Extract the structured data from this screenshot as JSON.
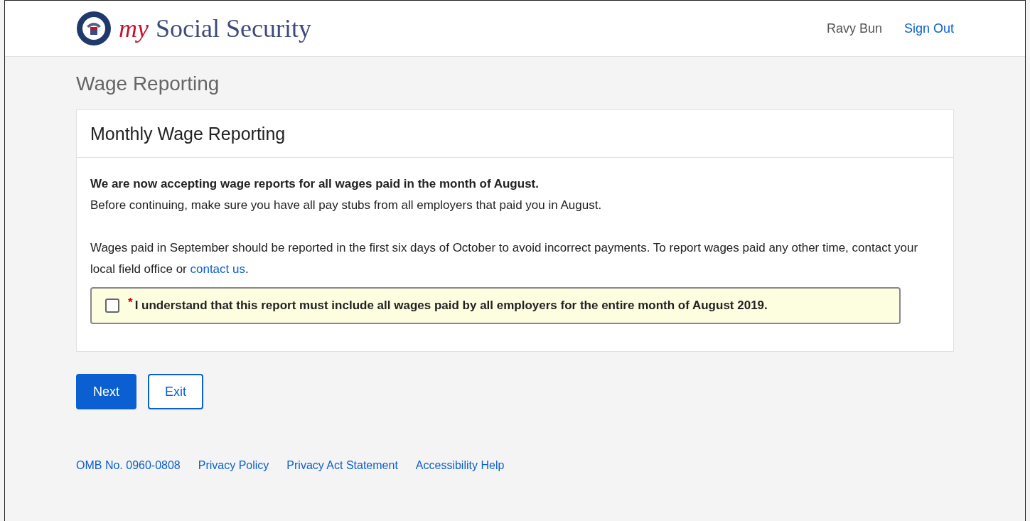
{
  "header": {
    "logo_prefix": "my",
    "logo_name": "Social Security",
    "user_name": "Ravy Bun",
    "sign_out": "Sign Out"
  },
  "page_title": "Wage Reporting",
  "card": {
    "title": "Monthly Wage Reporting",
    "lead": "We are now accepting wage reports for all wages paid in the month of August.",
    "intro": "Before continuing, make sure you have all pay stubs from all employers that paid you in August.",
    "notice_before": "Wages paid in September should be reported in the first six days of October to avoid incorrect payments. To report wages paid any other time, contact your local field office or ",
    "notice_link": "contact us",
    "notice_after": ".",
    "confirm": {
      "required_mark": "*",
      "label": "I understand that this report must include all wages paid by all employers for the entire month of August 2019.",
      "checked": false
    }
  },
  "buttons": [
    {
      "label": "Next",
      "kind": "primary"
    },
    {
      "label": "Exit",
      "kind": "secondary"
    }
  ],
  "footer_links": [
    "OMB No. 0960-0808",
    "Privacy Policy",
    "Privacy Act Statement",
    "Accessibility Help"
  ]
}
